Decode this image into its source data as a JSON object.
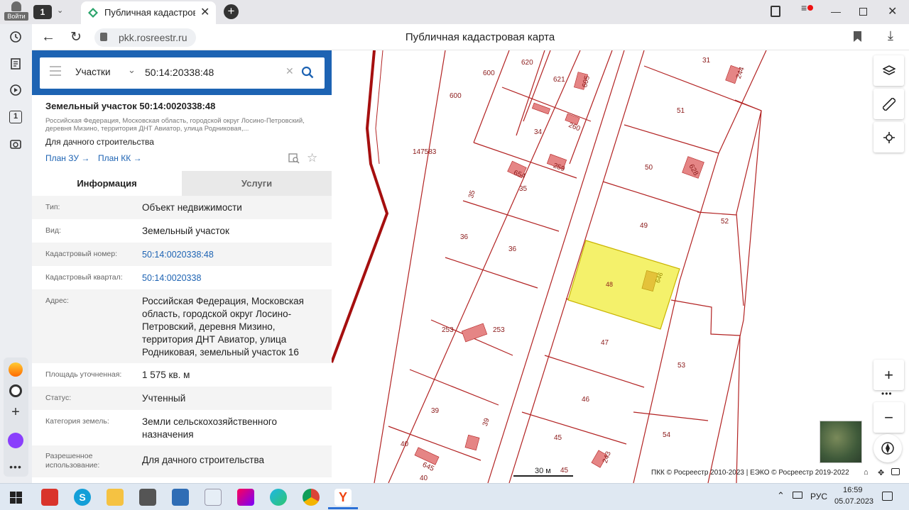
{
  "browser": {
    "login_label": "Войти",
    "tab_count": "1",
    "tab_title": "Публичная кадастровая карта",
    "url": "pkk.rosreestr.ru",
    "page_title": "Публичная кадастровая карта"
  },
  "search": {
    "category": "Участки",
    "query": "50:14:20338:48"
  },
  "parcel": {
    "title": "Земельный участок 50:14:0020338:48",
    "address_short": "Российская Федерация, Московская область, городской округ Лосино-Петровский, деревня Мизино, территория ДНТ Авиатор, улица Родниковая,...",
    "purpose": "Для дачного строительства",
    "plan_zu": "План ЗУ →",
    "plan_kk": "План КК →"
  },
  "tabs": {
    "info": "Информация",
    "services": "Услуги"
  },
  "info_rows": [
    {
      "label": "Тип:",
      "value": "Объект недвижимости"
    },
    {
      "label": "Вид:",
      "value": "Земельный участок"
    },
    {
      "label": "Кадастровый номер:",
      "value": "50:14:0020338:48"
    },
    {
      "label": "Кадастровый квартал:",
      "value": "50:14:0020338"
    },
    {
      "label": "Адрес:",
      "value": "Российская Федерация, Московская область, городской округ Лосино-Петровский, деревня Мизино, территория ДНТ Авиатор, улица Родниковая, земельный участок 16"
    },
    {
      "label": "Площадь уточненная:",
      "value": "1 575 кв. м"
    },
    {
      "label": "Статус:",
      "value": "Учтенный"
    },
    {
      "label": "Категория земель:",
      "value": "Земли сельскохозяйственного назначения"
    },
    {
      "label": "Разрешенное использование:",
      "value": "Для дачного строительства"
    }
  ],
  "map": {
    "scale": "30 м",
    "copyright": "ПКК © Росреестр 2010-2023 | ЕЭКО © Росреестр 2019-2022",
    "parcel_labels": [
      "600",
      "620",
      "621",
      "605",
      "31",
      "244",
      "600",
      "51",
      "34",
      "260",
      "147583",
      "50",
      "628",
      "654",
      "259",
      "35",
      "35",
      "52",
      "49",
      "36",
      "36",
      "48",
      "646",
      "253",
      "253",
      "47",
      "53",
      "39",
      "39",
      "46",
      "40",
      "645",
      "45",
      "243",
      "45",
      "40",
      "54"
    ]
  },
  "taskbar": {
    "lang": "РУС",
    "time": "16:59",
    "date": "05.07.2023"
  },
  "colors": {
    "accent_blue": "#1d63b3",
    "parcel_line": "#b22222",
    "selected_fill": "#f4f16b",
    "building": "#e58585"
  }
}
